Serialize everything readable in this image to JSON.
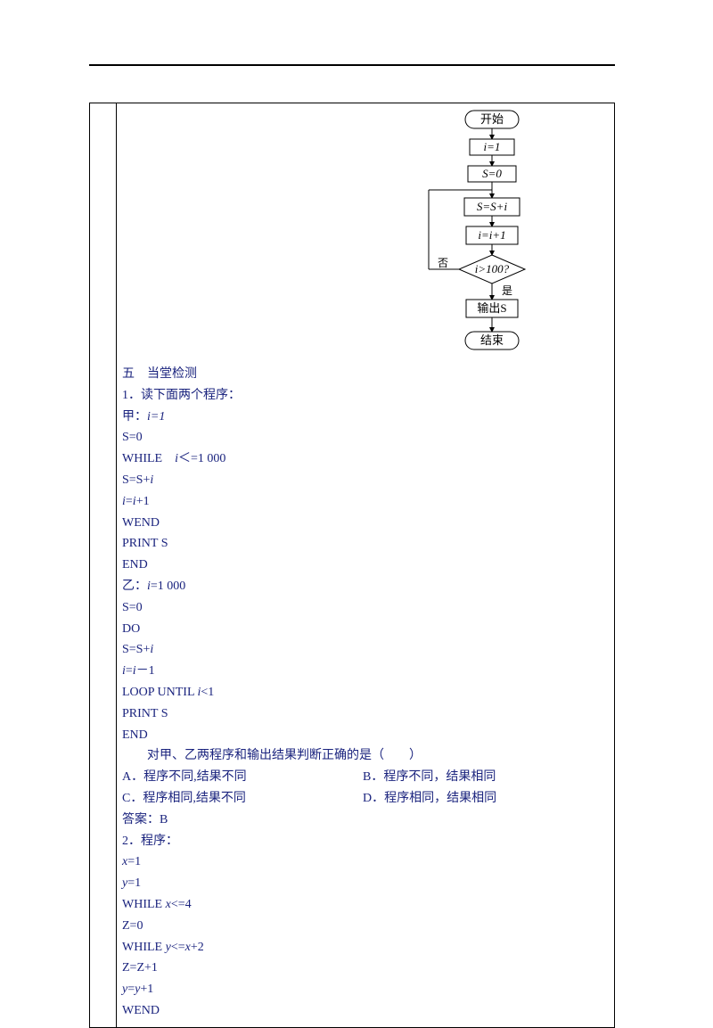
{
  "flowchart": {
    "start": "开始",
    "s1": "i=1",
    "s2": "S=0",
    "s3": "S=S+i",
    "s4": "i=i+1",
    "dec": "i>100?",
    "out": "输出S",
    "end": "结束",
    "no": "否",
    "yes": "是"
  },
  "section": {
    "title": "五　当堂检测",
    "q1_intro": "1．读下面两个程序：",
    "jia_label": "甲：",
    "jia": [
      "i=1",
      "S=0",
      "WHILE　i＜=1 000",
      "S=S+i",
      "i=i+1",
      "WEND",
      "PRINT S",
      "END"
    ],
    "yi_label": "乙：",
    "yi": [
      "i=1 000",
      "S=0",
      "DO",
      "S=S+i",
      "i=i－1",
      "LOOP UNTIL i<1",
      "PRINT S",
      "END"
    ],
    "q1_question": "对甲、乙两程序和输出结果判断正确的是（　　）",
    "opts": {
      "A": "A．程序不同,结果不同",
      "B": "B．程序不同，结果相同",
      "C": "C．程序相同,结果不同",
      "D": "D．程序相同，结果相同"
    },
    "answer1": "答案：B",
    "q2_intro": "2．程序：",
    "q2": [
      "x=1",
      "y=1",
      "WHILE x<=4",
      "Z=0",
      "WHILE y<=x+2",
      "Z=Z+1",
      "y=y+1",
      "WEND"
    ]
  }
}
